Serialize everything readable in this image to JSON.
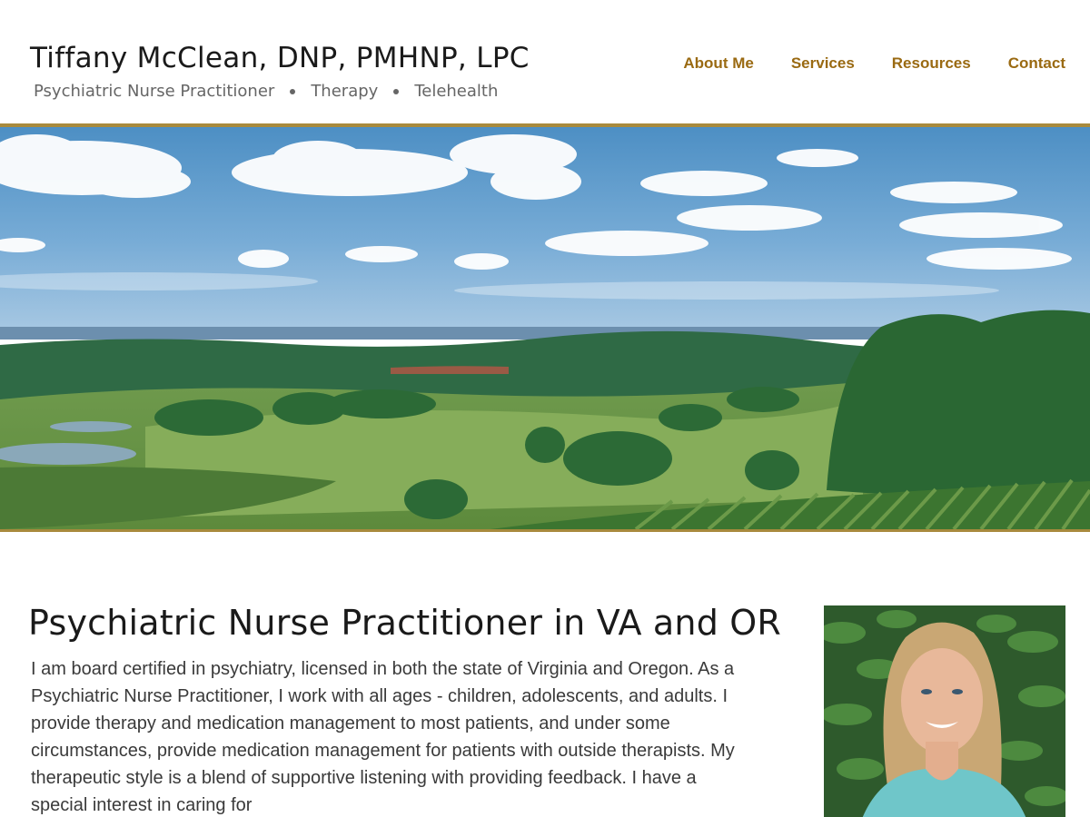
{
  "header": {
    "title": "Tiffany McClean, DNP, PMHNP, LPC",
    "tagline": [
      "Psychiatric Nurse Practitioner",
      "Therapy",
      "Telehealth"
    ]
  },
  "nav": {
    "items": [
      "About Me",
      "Services",
      "Resources",
      "Contact"
    ]
  },
  "hero": {
    "alt": "Rolling green hills, vineyard rows and blue sky with white clouds"
  },
  "main": {
    "heading": "Psychiatric Nurse Practitioner in VA and OR",
    "bio": "I am board certified in psychiatry, licensed in both the state of Virginia and Oregon. As a Psychiatric Nurse Practitioner, I work with all ages - children, adolescents, and adults. I provide therapy and medication management to most patients, and under some circumstances, provide medication management for patients with outside therapists. My therapeutic style is a blend of supportive listening with providing feedback. I have a special interest in caring for"
  },
  "colors": {
    "accent": "#9a6a12",
    "divider": "#a88a3d"
  }
}
